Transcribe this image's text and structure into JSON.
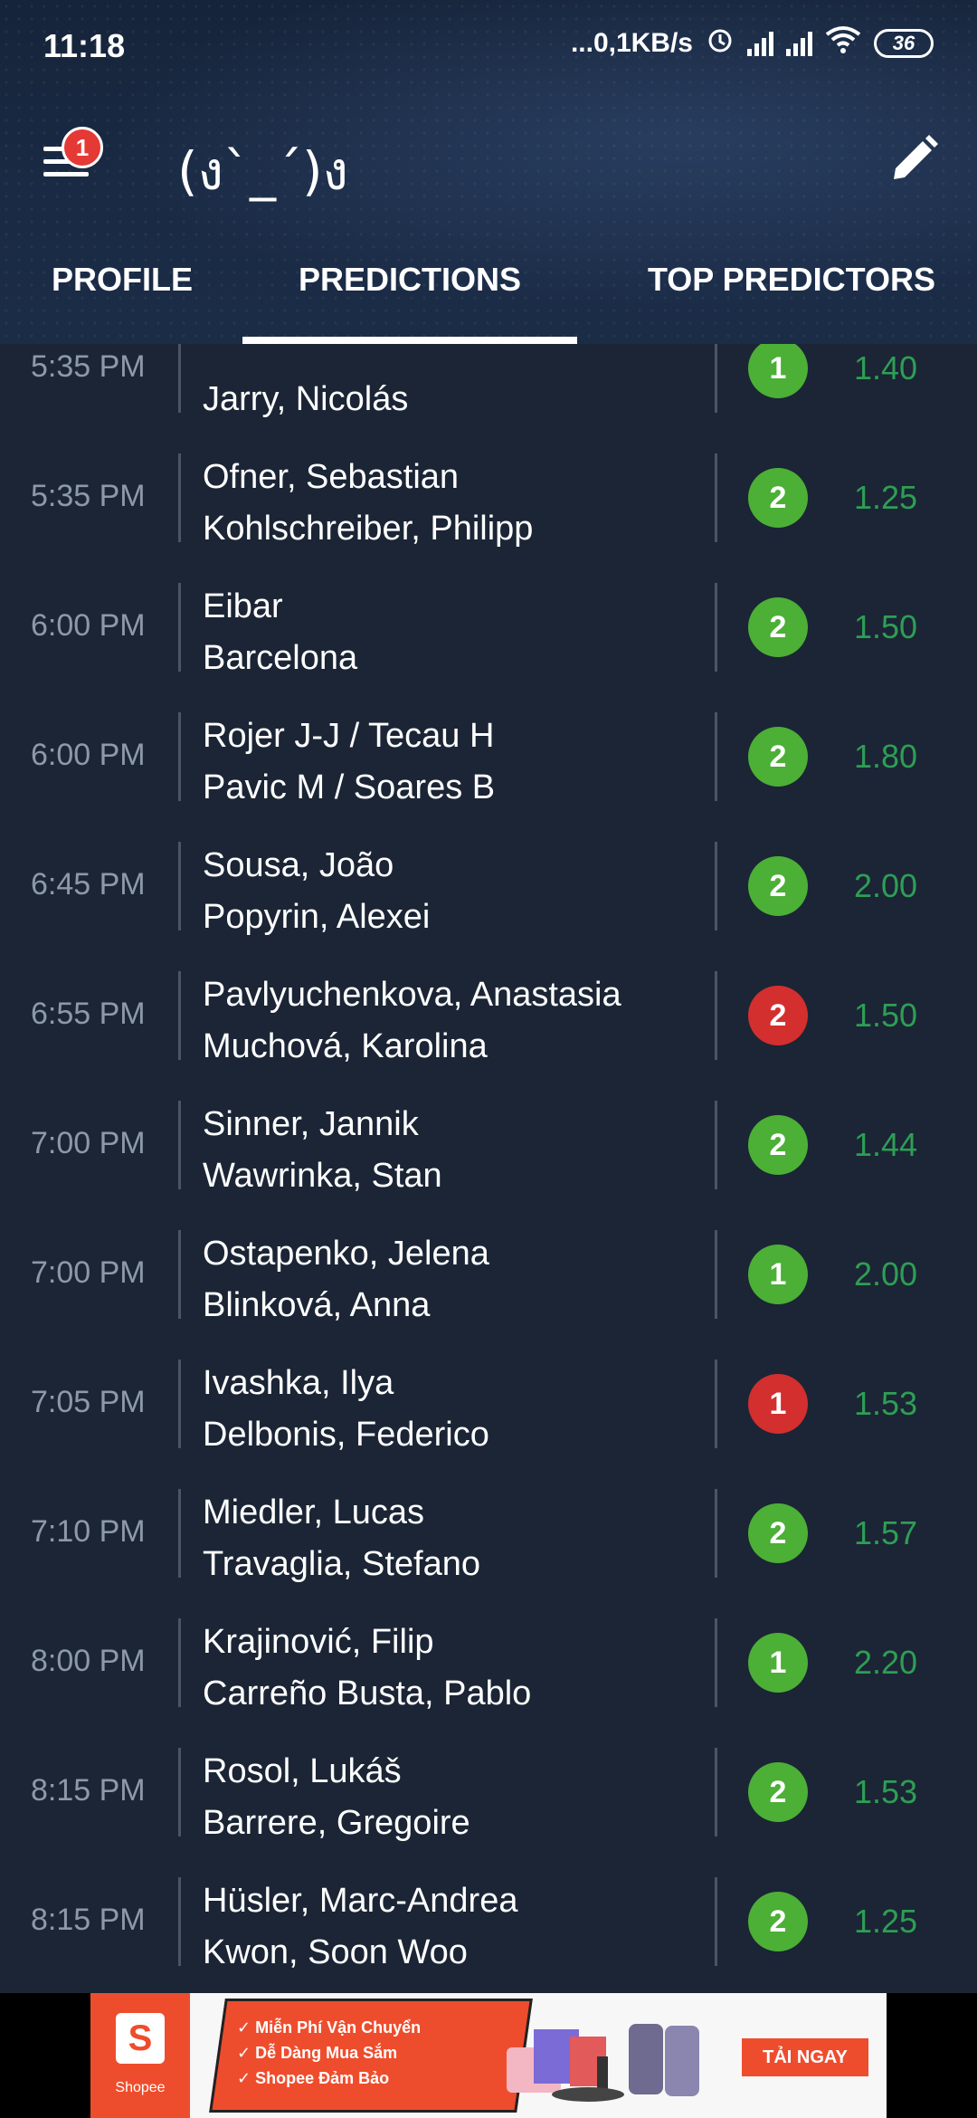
{
  "status_bar": {
    "time": "11:18",
    "network_speed": "...0,1KB/s",
    "battery": "36",
    "icons": [
      "alarm-icon",
      "signal-icon",
      "signal-icon",
      "wifi-icon",
      "battery-icon"
    ]
  },
  "app_bar": {
    "title": "(ง`_´)ง",
    "menu_badge": "1"
  },
  "tabs": [
    {
      "label": "PROFILE"
    },
    {
      "label": "PREDICTIONS",
      "active": true
    },
    {
      "label": "TOP PREDICTORS"
    }
  ],
  "predictions": [
    {
      "time": "5:35 PM",
      "team1": "",
      "team2": "Jarry, Nicolás",
      "pick": "1",
      "status": "won",
      "odds": "1.40"
    },
    {
      "time": "5:35 PM",
      "team1": "Ofner, Sebastian",
      "team2": "Kohlschreiber, Philipp",
      "pick": "2",
      "status": "won",
      "odds": "1.25"
    },
    {
      "time": "6:00 PM",
      "team1": "Eibar",
      "team2": "Barcelona",
      "pick": "2",
      "status": "won",
      "odds": "1.50"
    },
    {
      "time": "6:00 PM",
      "team1": "Rojer J-J / Tecau H",
      "team2": "Pavic M / Soares B",
      "pick": "2",
      "status": "won",
      "odds": "1.80"
    },
    {
      "time": "6:45 PM",
      "team1": "Sousa, João",
      "team2": "Popyrin, Alexei",
      "pick": "2",
      "status": "won",
      "odds": "2.00"
    },
    {
      "time": "6:55 PM",
      "team1": "Pavlyuchenkova, Anastasia",
      "team2": "Muchová, Karolina",
      "pick": "2",
      "status": "lost",
      "odds": "1.50"
    },
    {
      "time": "7:00 PM",
      "team1": "Sinner, Jannik",
      "team2": "Wawrinka, Stan",
      "pick": "2",
      "status": "won",
      "odds": "1.44"
    },
    {
      "time": "7:00 PM",
      "team1": "Ostapenko, Jelena",
      "team2": "Blinková, Anna",
      "pick": "1",
      "status": "won",
      "odds": "2.00"
    },
    {
      "time": "7:05 PM",
      "team1": "Ivashka, Ilya",
      "team2": "Delbonis, Federico",
      "pick": "1",
      "status": "lost",
      "odds": "1.53"
    },
    {
      "time": "7:10 PM",
      "team1": "Miedler, Lucas",
      "team2": "Travaglia, Stefano",
      "pick": "2",
      "status": "won",
      "odds": "1.57"
    },
    {
      "time": "8:00 PM",
      "team1": "Krajinović, Filip",
      "team2": "Carreño Busta, Pablo",
      "pick": "1",
      "status": "won",
      "odds": "2.20"
    },
    {
      "time": "8:15 PM",
      "team1": "Rosol, Lukáš",
      "team2": "Barrere, Gregoire",
      "pick": "2",
      "status": "won",
      "odds": "1.53"
    },
    {
      "time": "8:15 PM",
      "team1": "Hüsler, Marc-Andrea",
      "team2": "Kwon, Soon Woo",
      "pick": "2",
      "status": "won",
      "odds": "1.25"
    }
  ],
  "colors": {
    "won": "#4caf36",
    "lost": "#d32f2f",
    "odds": "#2e9e55",
    "background": "#1b2535"
  },
  "ad": {
    "brand": "Shopee",
    "logo_letter": "S",
    "lines": [
      "✓ Miễn Phí Vận Chuyển",
      "✓ Dễ Dàng Mua Sắm",
      "✓ Shopee Đảm Bảo"
    ],
    "cta": "TẢI NGAY"
  }
}
